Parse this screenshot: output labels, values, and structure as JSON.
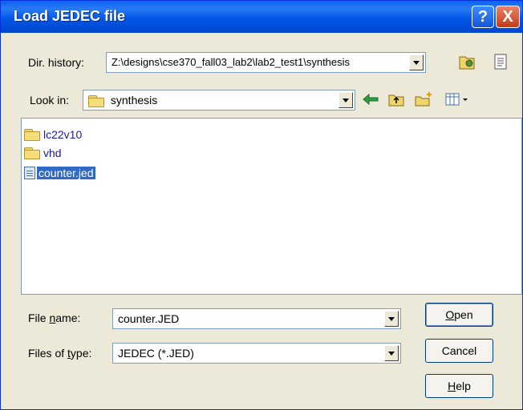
{
  "window": {
    "title": "Load JEDEC file",
    "help_icon": "?",
    "close_icon": "X"
  },
  "dir_history": {
    "label": "Dir. history:",
    "value": "Z:\\designs\\cse370_fall03_lab2\\lab2_test1\\synthesis"
  },
  "look_in": {
    "label": "Look in:",
    "value": "synthesis"
  },
  "toolbar": {
    "icons": [
      "back-arrow-icon",
      "up-folder-icon",
      "new-folder-icon",
      "view-menu-icon"
    ]
  },
  "file_list": [
    {
      "name": "lc22v10",
      "type": "folder"
    },
    {
      "name": "vhd",
      "type": "folder"
    },
    {
      "name": "counter.jed",
      "type": "file",
      "selected": true
    }
  ],
  "file_name": {
    "label": "File name:",
    "value": "counter.JED"
  },
  "files_of_type": {
    "label": "Files of type:",
    "value": "JEDEC (*.JED)"
  },
  "buttons": {
    "open": "Open",
    "cancel": "Cancel",
    "help": "Help"
  },
  "colors": {
    "titlebar": "#0058e6",
    "selection": "#316ac5",
    "face": "#ece9d8"
  }
}
